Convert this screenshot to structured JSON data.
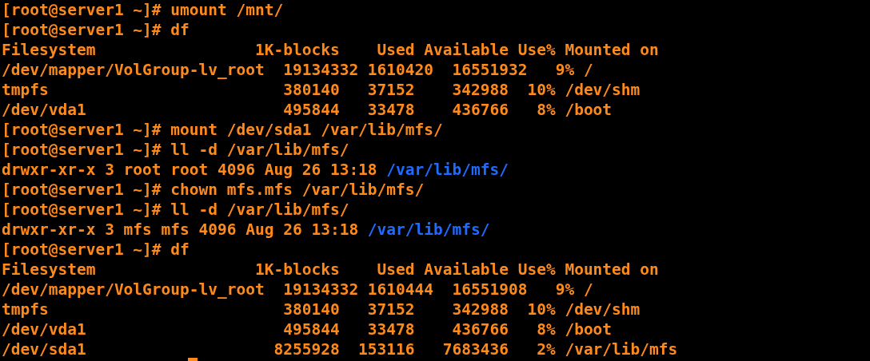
{
  "terminal": {
    "lines": [
      [
        {
          "text": "[root@server1 ~]# umount /mnt/",
          "color": "#ff8a1c"
        }
      ],
      [
        {
          "text": "[root@server1 ~]# df",
          "color": "#ff8a1c"
        }
      ],
      [
        {
          "text": "Filesystem                 1K-blocks    Used Available Use% Mounted on",
          "color": "#ff8a1c"
        }
      ],
      [
        {
          "text": "/dev/mapper/VolGroup-lv_root  19134332 1610420  16551932   9% /",
          "color": "#ff8a1c"
        }
      ],
      [
        {
          "text": "tmpfs                         380140   37152    342988  10% /dev/shm",
          "color": "#ff8a1c"
        }
      ],
      [
        {
          "text": "/dev/vda1                     495844   33478    436766   8% /boot",
          "color": "#ff8a1c"
        }
      ],
      [
        {
          "text": "[root@server1 ~]# mount /dev/sda1 /var/lib/mfs/",
          "color": "#ff8a1c"
        }
      ],
      [
        {
          "text": "[root@server1 ~]# ll -d /var/lib/mfs/",
          "color": "#ff8a1c"
        }
      ],
      [
        {
          "text": "drwxr-xr-x 3 root root 4096 Aug 26 13:18",
          "color": "#ff8a1c"
        },
        {
          "text": "/var/lib/mfs/",
          "color": "#1f6bff"
        }
      ],
      [
        {
          "text": "[root@server1 ~]# chown mfs.mfs /var/lib/mfs/",
          "color": "#ff8a1c"
        }
      ],
      [
        {
          "text": "[root@server1 ~]# ll -d /var/lib/mfs/",
          "color": "#ff8a1c"
        }
      ],
      [
        {
          "text": "drwxr-xr-x 3 mfs mfs 4096 Aug 26 13:18",
          "color": "#ff8a1c"
        },
        {
          "text": "/var/lib/mfs/",
          "color": "#1f6bff"
        }
      ],
      [
        {
          "text": "[root@server1 ~]# df",
          "color": "#ff8a1c"
        }
      ],
      [
        {
          "text": "Filesystem                 1K-blocks    Used Available Use% Mounted on",
          "color": "#ff8a1c"
        }
      ],
      [
        {
          "text": "/dev/mapper/VolGroup-lv_root  19134332 1610444  16551908   9% /",
          "color": "#ff8a1c"
        }
      ],
      [
        {
          "text": "tmpfs                         380140   37152    342988  10% /dev/shm",
          "color": "#ff8a1c"
        }
      ],
      [
        {
          "text": "/dev/vda1                     495844   33478    436766   8% /boot",
          "color": "#ff8a1c"
        }
      ],
      [
        {
          "text": "/dev/sda1                    8255928  153116   7683436   2% /var/lib/mfs",
          "color": "#ff8a1c"
        }
      ]
    ],
    "cursor_visible": true
  }
}
